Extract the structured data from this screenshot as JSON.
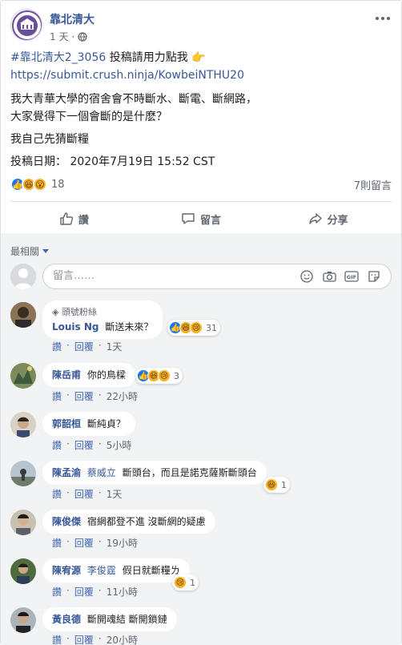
{
  "post": {
    "page_name": "靠北清大",
    "time": "1 天",
    "privacy_icon": "globe-icon",
    "hashtag": "#靠北清大2_3056",
    "intro": " 投稿請用力點我 ",
    "point_emoji": "👉",
    "link": "https://submit.crush.ninja/KowbeiNTHU20",
    "line1": "我大青華大學的宿舍會不時斷水、斷電、斷網路，",
    "line2": "大家覺得下一個會斷的是什麽？",
    "line3": "我自己先猜斷糧",
    "submitted": "投稿日期： 2020年7月19日 15:52 CST",
    "reaction_count": "18",
    "comment_count": "7則留言"
  },
  "actions": {
    "like": "讚",
    "comment": "留言",
    "share": "分享"
  },
  "comments_section": {
    "sort_label": "最相關",
    "composer_placeholder": "留言……",
    "gif_label": "GIF"
  },
  "comments": [
    {
      "badge": "頭號粉絲",
      "author": "Louis Ng",
      "mention": "",
      "text": "斷送未來？",
      "reactions": [
        "like",
        "haha",
        "sad"
      ],
      "react_count": "31",
      "like_label": "讚",
      "reply_label": "回覆",
      "time": "1天"
    },
    {
      "badge": "",
      "author": "陳岳甫",
      "mention": "",
      "text": "你的鳥樑",
      "reactions": [
        "like",
        "haha",
        "sad"
      ],
      "react_count": "3",
      "like_label": "讚",
      "reply_label": "回覆",
      "time": "22小時"
    },
    {
      "badge": "",
      "author": "郭韶桓",
      "mention": "",
      "text": "斷純貞？",
      "reactions": [],
      "react_count": "",
      "like_label": "讚",
      "reply_label": "回覆",
      "time": "5小時"
    },
    {
      "badge": "",
      "author": "陳孟渝",
      "mention": "蔡威立",
      "text": "斷頭台，而且是諾克薩斯斷頭台",
      "reactions": [
        "haha"
      ],
      "react_count": "1",
      "like_label": "讚",
      "reply_label": "回覆",
      "time": "1天"
    },
    {
      "badge": "",
      "author": "陳俊傑",
      "mention": "",
      "text": "宿網都登不進 沒斷網的疑慮",
      "reactions": [],
      "react_count": "",
      "like_label": "讚",
      "reply_label": "回覆",
      "time": "19小時"
    },
    {
      "badge": "",
      "author": "陳宥源",
      "mention": "李俊霆",
      "text": "假日就斷糧ㄌ",
      "reactions": [
        "sad"
      ],
      "react_count": "1",
      "like_label": "讚",
      "reply_label": "回覆",
      "time": "11小時"
    },
    {
      "badge": "",
      "author": "黃良德",
      "mention": "",
      "text": "斷開魂結 斷開鎖鏈",
      "reactions": [],
      "react_count": "",
      "like_label": "讚",
      "reply_label": "回覆",
      "time": "20小時"
    }
  ],
  "colors": {
    "link": "#385898",
    "like_blue": "#1877f2",
    "muted": "#606770",
    "comment_bg": "#f2f3f5"
  }
}
